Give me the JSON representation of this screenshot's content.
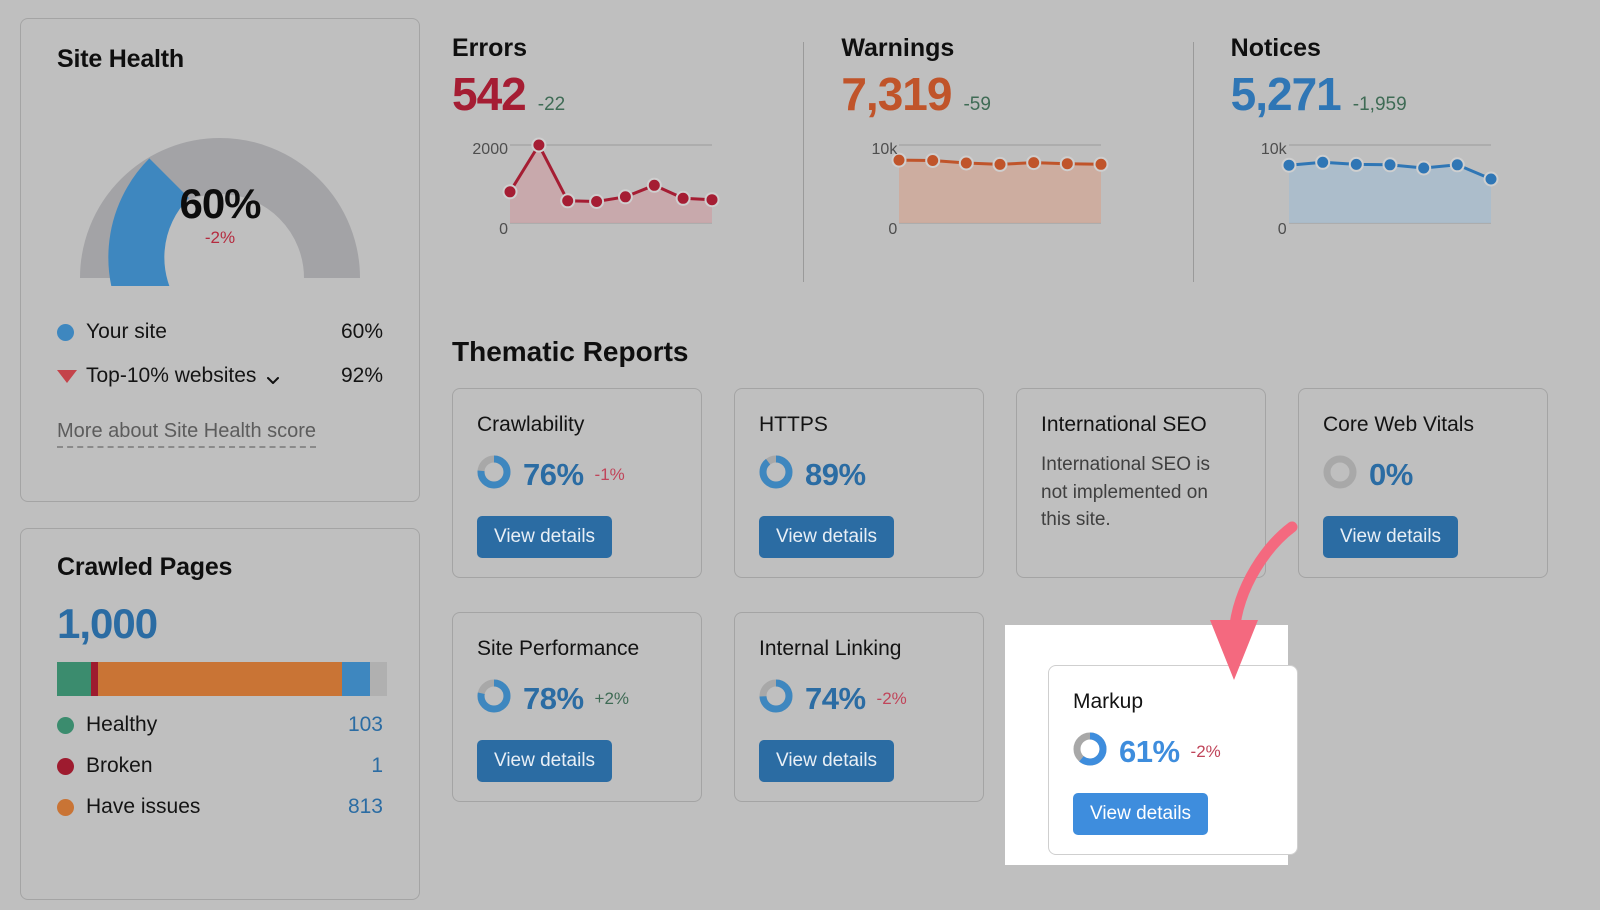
{
  "site_health": {
    "title": "Site Health",
    "gauge_value": "60%",
    "gauge_delta": "-2%",
    "score": 60,
    "benchmark": 92,
    "legend": [
      {
        "label": "Your site",
        "value": "60%",
        "marker": "dot",
        "color": "#3e87bf"
      },
      {
        "label": "Top-10% websites",
        "value": "92%",
        "marker": "triangle",
        "color": "#c4434a"
      }
    ],
    "more_link": "More about Site Health score"
  },
  "crawled_pages": {
    "title": "Crawled Pages",
    "total": "1,000",
    "rows": [
      {
        "label": "Healthy",
        "value": "103",
        "color": "#3b8c6e"
      },
      {
        "label": "Broken",
        "value": "1",
        "color": "#9e1b2f"
      },
      {
        "label": "Have issues",
        "value": "813",
        "color": "#c97435"
      }
    ],
    "bar_segments": [
      {
        "name": "healthy",
        "color": "#3b8c6e",
        "pct": 10.3
      },
      {
        "name": "broken",
        "color": "#9e1b2f",
        "pct": 2.0
      },
      {
        "name": "have-issues",
        "color": "#c97435",
        "pct": 74.0
      },
      {
        "name": "redirects",
        "color": "#3e87bf",
        "pct": 8.7
      },
      {
        "name": "blocked",
        "color": "#b0b0b0",
        "pct": 5.0
      }
    ]
  },
  "metrics": [
    {
      "title": "Errors",
      "value": "542",
      "delta": "-22",
      "color": "#a51d33",
      "fill": "#c9a5a8",
      "axis_top": "2000",
      "axis_bottom": "0",
      "chart_data": {
        "type": "line",
        "title": "Errors",
        "ylim": [
          0,
          2000
        ],
        "values": [
          700,
          2000,
          450,
          430,
          560,
          880,
          520,
          480
        ]
      }
    },
    {
      "title": "Warnings",
      "value": "7,319",
      "delta": "-59",
      "color": "#c0542a",
      "fill": "#cfa99a",
      "axis_top": "10k",
      "axis_bottom": "0",
      "chart_data": {
        "type": "area",
        "title": "Warnings",
        "ylim": [
          0,
          10000
        ],
        "values": [
          7900,
          7850,
          7500,
          7300,
          7550,
          7400,
          7319
        ]
      }
    },
    {
      "title": "Notices",
      "value": "5,271",
      "delta": "-1,959",
      "color": "#2f76b5",
      "fill": "#a8bccd",
      "axis_top": "10k",
      "axis_bottom": "0",
      "chart_data": {
        "type": "area",
        "title": "Notices",
        "ylim": [
          0,
          10000
        ],
        "values": [
          7200,
          7600,
          7300,
          7250,
          6800,
          7250,
          5271
        ]
      }
    }
  ],
  "thematic": {
    "title": "Thematic Reports",
    "button_label": "View details",
    "cards": [
      {
        "title": "Crawlability",
        "pct": "76%",
        "value": 76,
        "delta": "-1%",
        "delta_dir": "neg",
        "has_button": true
      },
      {
        "title": "HTTPS",
        "pct": "89%",
        "value": 89,
        "delta": "",
        "delta_dir": "",
        "has_button": true
      },
      {
        "title": "International SEO",
        "pct": "",
        "value": 0,
        "delta": "",
        "delta_dir": "",
        "has_button": false,
        "note": "International SEO is not implemented on this site."
      },
      {
        "title": "Core Web Vitals",
        "pct": "0%",
        "value": 0,
        "delta": "",
        "delta_dir": "",
        "has_button": true
      },
      {
        "title": "Site Performance",
        "pct": "78%",
        "value": 78,
        "delta": "+2%",
        "delta_dir": "pos",
        "has_button": true
      },
      {
        "title": "Internal Linking",
        "pct": "74%",
        "value": 74,
        "delta": "-2%",
        "delta_dir": "neg",
        "has_button": true
      }
    ]
  },
  "spotlight": {
    "card": {
      "title": "Markup",
      "pct": "61%",
      "value": 61,
      "delta": "-2%",
      "delta_dir": "neg"
    },
    "button_label": "View details",
    "arrow_color": "#f4697f"
  }
}
